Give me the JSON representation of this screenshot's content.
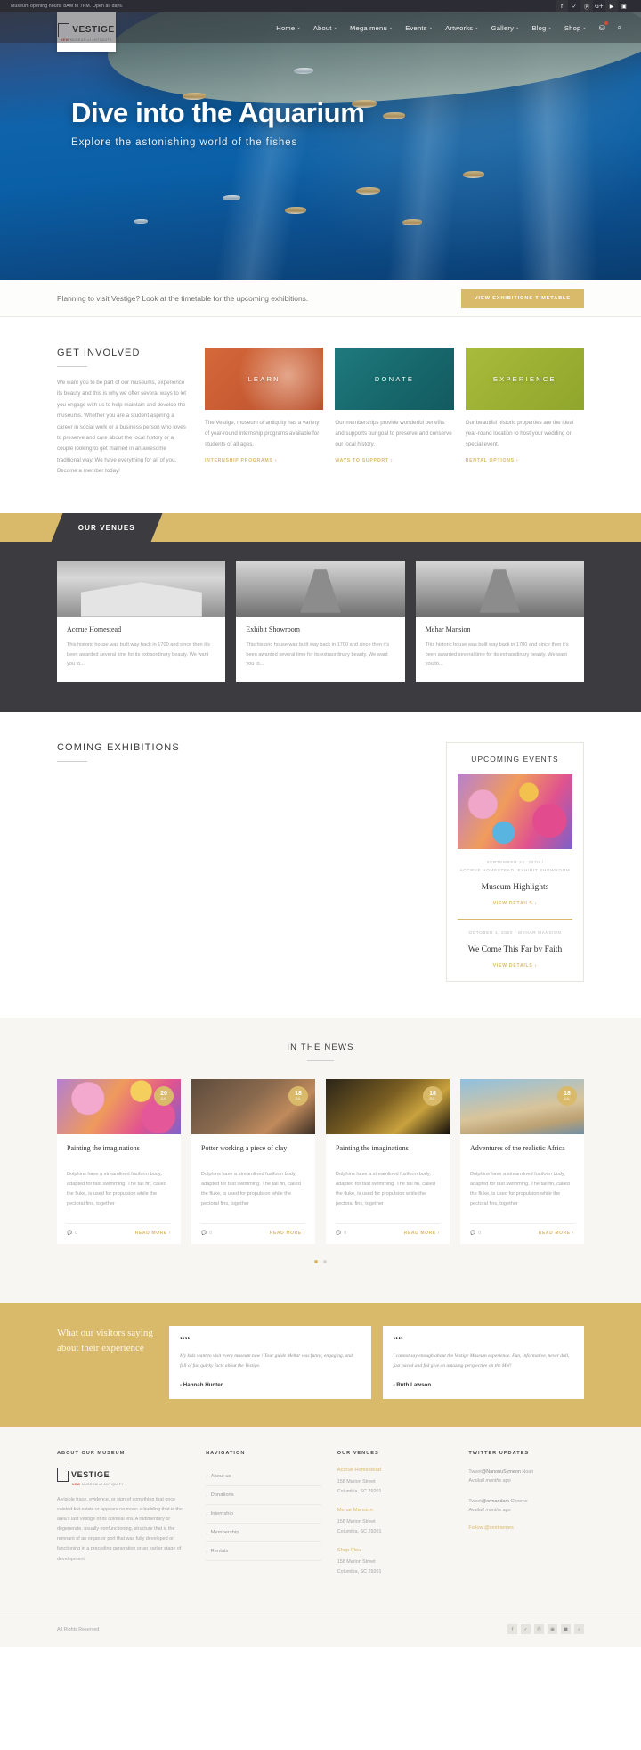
{
  "topbar": {
    "hours": "Museum opening hours: 8AM to 7PM. Open all days.",
    "social": [
      {
        "name": "facebook-icon",
        "glyph": "f"
      },
      {
        "name": "twitter-icon",
        "glyph": "✓"
      },
      {
        "name": "pinterest-icon",
        "glyph": "Ⓟ"
      },
      {
        "name": "google-plus-icon",
        "glyph": "G+"
      },
      {
        "name": "youtube-icon",
        "glyph": "▶"
      },
      {
        "name": "instagram-icon",
        "glyph": "▣"
      }
    ]
  },
  "logo": {
    "word": "VESTIGE",
    "sub_new": "NEW",
    "sub_rest": "MUSEUM of ANTIQUITY"
  },
  "nav": {
    "items": [
      {
        "label": "Home",
        "caret": "⌄"
      },
      {
        "label": "About",
        "caret": "⌄"
      },
      {
        "label": "Mega menu",
        "caret": "⌄"
      },
      {
        "label": "Events",
        "caret": "⌄"
      },
      {
        "label": "Artworks",
        "caret": "⌄"
      },
      {
        "label": "Gallery",
        "caret": "⌄"
      },
      {
        "label": "Blog",
        "caret": "⌄"
      },
      {
        "label": "Shop",
        "caret": "⌄"
      }
    ],
    "cart_icon": "⛁",
    "search_icon": "⌕"
  },
  "hero": {
    "title": "Dive into the Aquarium",
    "subtitle": "Explore the astonishing world of the fishes"
  },
  "strip": {
    "text": "Planning to visit Vestige? Look at the timetable for the upcoming exhibitions.",
    "button": "VIEW EXHIBITIONS TIMETABLE"
  },
  "get_involved": {
    "title": "GET INVOLVED",
    "body": "We want you to be part of our museums, experience its beauty and this is why we offer several ways to let you engage with us to help maintain and develop the museums. Whether you are a student aspiring a career in social work or a business person who loves to preserve and care about the local history or a couple looking to get married in an awesome traditional way. We have everything for all of you. Become a member today!",
    "cards": [
      {
        "label": "LEARN",
        "text": "The Vestige, museum of antiquity has a variety of year-round internship programs available for students of all ages.",
        "link": "INTERNSHIP PROGRAMS ›"
      },
      {
        "label": "DONATE",
        "text": "Our memberships provide wonderful benefits and supports our goal to preserve and conserve our local history.",
        "link": "WAYS TO SUPPORT ›"
      },
      {
        "label": "EXPERIENCE",
        "text": "Our beautiful historic properties are the ideal year-round location to host your wedding or special event.",
        "link": "RENTAL OPTIONS ›"
      }
    ]
  },
  "venues": {
    "band_label": "OUR VENUES",
    "cards": [
      {
        "name": "Accrue Homestead",
        "text": "This historic house was built way back in 1700 and since then it's been awarded several time for its extraordinary beauty. We want you to..."
      },
      {
        "name": "Exhibit Showroom",
        "text": "This historic house was built way back in 1700 and since then it's been awarded several time for its extraordinary beauty. We want you to..."
      },
      {
        "name": "Mehar Mansion",
        "text": "This historic house was built way back in 1700 and since then it's been awarded several time for its extraordinary beauty. We want you to..."
      }
    ]
  },
  "exhibitions": {
    "title": "COMING EXHIBITIONS",
    "events_title": "UPCOMING EVENTS",
    "events": [
      {
        "date": "SEPTEMBER 24, 2020",
        "sep": "/",
        "venue": "ACCRUE HOMESTEAD, EXHIBIT SHOWROOM",
        "title": "Museum Highlights",
        "link": "VIEW DETAILS ›"
      },
      {
        "date": "OCTOBER 1, 2020",
        "sep": "/",
        "venue": "MEHAR MANSION",
        "title": "We Come This Far by Faith",
        "link": "VIEW DETAILS ›"
      }
    ]
  },
  "news": {
    "title": "IN THE NEWS",
    "read_more": "READ MORE ›",
    "cards": [
      {
        "day": "20",
        "month": "JUL",
        "title": "Painting the imaginations",
        "text": "Dolphins have a streamlined fusiform body, adapted for fast swimming. The tail fin, called the fluke, is used for propulsion while the pectoral fins, together",
        "comments": "0"
      },
      {
        "day": "18",
        "month": "JUL",
        "title": "Potter working a piece of clay",
        "text": "Dolphins have a streamlined fusiform body, adapted for fast swimming. The tail fin, called the fluke, is used for propulsion while the pectoral fins, together",
        "comments": "0"
      },
      {
        "day": "18",
        "month": "JUL",
        "title": "Painting the imaginations",
        "text": "Dolphins have a streamlined fusiform body, adapted for fast swimming. The tail fin, called the fluke, is used for propulsion while the pectoral fins, together",
        "comments": "0"
      },
      {
        "day": "18",
        "month": "JUL",
        "title": "Adventures of the realistic Africa",
        "text": "Dolphins have a streamlined fusiform body, adapted for fast swimming. The tail fin, called the fluke, is used for propulsion while the pectoral fins, together",
        "comments": "0"
      }
    ]
  },
  "testimonials": {
    "heading": "What our visitors saying about their experience",
    "items": [
      {
        "quote": "My kids want to visit every museum now ! Tour guide Mehar was funny, engaging, and full of fun quirky facts about the Vestige.",
        "author": "- Hannah Hunter"
      },
      {
        "quote": "I cannot say enough about the Vestige Museum experience. Fun, informative, never dull, fast paced and fed give an amazing perspective on the Mel!",
        "author": "- Ruth Lawson"
      }
    ]
  },
  "footer": {
    "about": {
      "head": "ABOUT OUR MUSEUM",
      "text": "A visible trace, evidence, or sign of something that once existed but exists or appears no more: a building that is the area's last vestige of its colonial era. A rudimentary or degenerate, usually nonfunctioning, structure that is the remnant of an organ or port that was fully developed or functioning in a preceding generation or an earlier stage of development."
    },
    "navigation": {
      "head": "NAVIGATION",
      "items": [
        "About us",
        "Donations",
        "Internship",
        "Membership",
        "Rentals"
      ]
    },
    "venues": {
      "head": "OUR VENUES",
      "items": [
        {
          "name": "Accrue Homestead",
          "street": "158 Marion Street",
          "city": "Columbia, SC 29201"
        },
        {
          "name": "Mehar Mansion",
          "street": "158 Marion Street",
          "city": "Columbia, SC 29201"
        },
        {
          "name": "Shop Pleu",
          "street": "158 Marion Street",
          "city": "Columbia, SC 29201"
        }
      ]
    },
    "twitter": {
      "head": "TWITTER UPDATES",
      "tweets": [
        {
          "prefix": "Tweet",
          "handle": "@NanouuSymeon",
          "rest": "Noah",
          "suffix": "Availa",
          "time": "0 months ago"
        },
        {
          "prefix": "Tweet",
          "handle": "@ormandark",
          "rest": "Chrome",
          "suffix": "Availa",
          "time": "0 months ago"
        }
      ],
      "follow": "Follow @smithemes"
    }
  },
  "copyright": {
    "text": "All Rights Reserved",
    "social": [
      {
        "name": "facebook-icon",
        "glyph": "f"
      },
      {
        "name": "twitter-icon",
        "glyph": "✓"
      },
      {
        "name": "pinterest-icon",
        "glyph": "Ⓟ"
      },
      {
        "name": "youtube-icon",
        "glyph": "▣"
      },
      {
        "name": "instagram-icon",
        "glyph": "■"
      },
      {
        "name": "search-icon",
        "glyph": "⌕"
      }
    ]
  }
}
